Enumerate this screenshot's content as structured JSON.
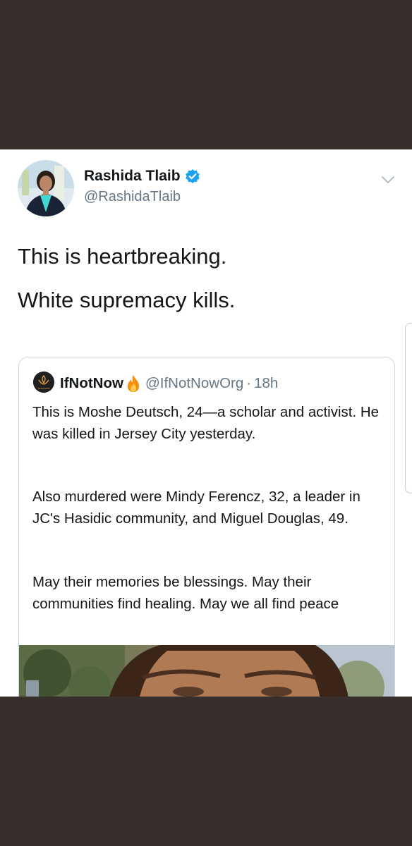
{
  "tweet": {
    "author_name": "Rashida Tlaib",
    "author_handle": "@RashidaTlaib",
    "text_lines": [
      "This is heartbreaking.",
      "White supremacy kills."
    ]
  },
  "quoted_tweet": {
    "name": "IfNotNow",
    "handle": "@IfNotNowOrg",
    "separator": "·",
    "time": "18h",
    "avatar_caption": "IFNOTNOW",
    "paragraphs": [
      "This is Moshe Deutsch, 24—a scholar and activist. He was killed in Jersey City yesterday.",
      "Also murdered were Mindy Ferencz, 32, a leader in JC's Hasidic community, and Miguel Douglas, 49.",
      "May their memories be blessings. May their communities find healing. May we all find peace"
    ]
  },
  "icons": {
    "verified": "verified-badge-icon",
    "menu": "chevron-down-icon",
    "emoji": "fire-emoji-icon"
  },
  "colors": {
    "background_band": "#382f2d",
    "name_text": "#14171a",
    "secondary_text": "#657786",
    "verified_blue": "#1da1f2"
  }
}
